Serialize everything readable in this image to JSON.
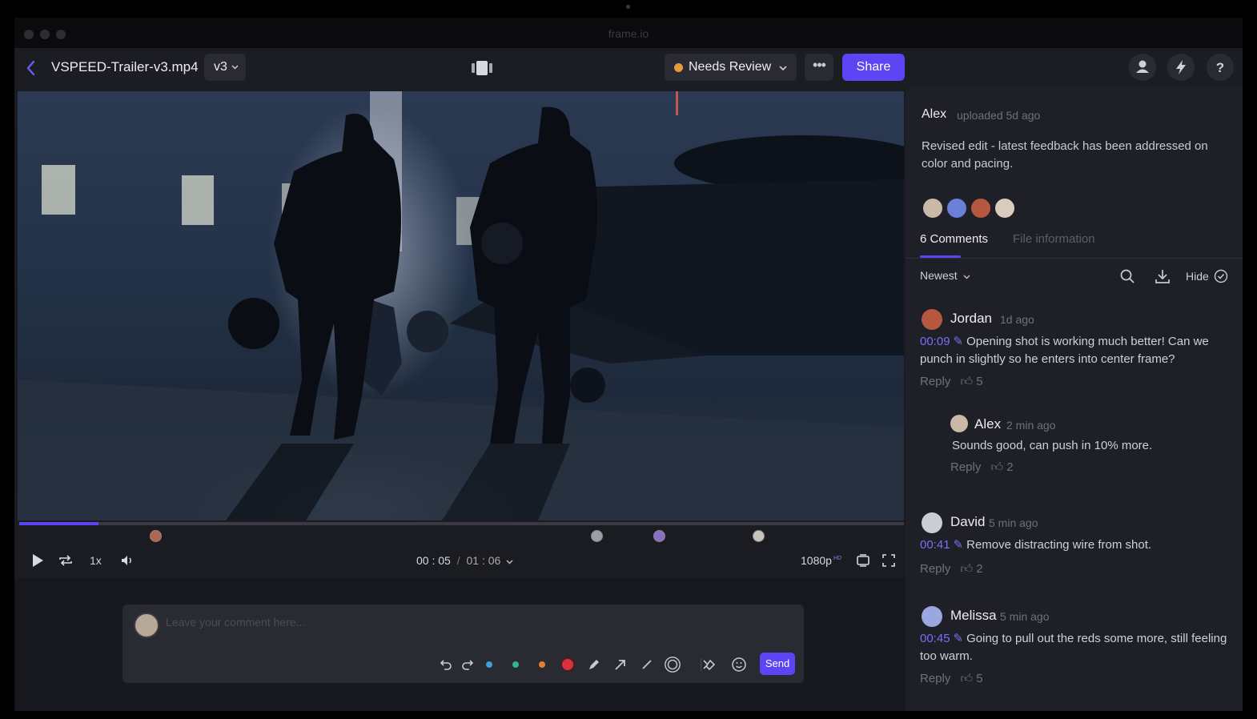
{
  "window": {
    "title": "frame.io"
  },
  "header": {
    "file_name": "VSPEED-Trailer-v3.mp4",
    "version": "v3",
    "status": "Needs Review",
    "status_color": "#e59a3e",
    "share_label": "Share",
    "more_label": "•••",
    "accent_color": "#5b45f5",
    "icons": [
      "back-chevron-icon",
      "multi-view-icon",
      "user-icon",
      "lightning-icon",
      "help-icon"
    ]
  },
  "player": {
    "progress": 0.09,
    "speed": "1x",
    "current_time": "00 : 05",
    "separator": "/",
    "duration": "01 : 06",
    "quality": "1080p",
    "quality_badge": "HD",
    "comment_markers_fraction": [
      0.155,
      0.65,
      0.72,
      0.83
    ]
  },
  "composer": {
    "placeholder": "Leave your comment here...",
    "send_label": "Send",
    "colors": [
      "#3aa1d9",
      "#2fb58f",
      "#e3812f",
      "#d9323a"
    ]
  },
  "panel": {
    "uploader": "Alex",
    "upload_meta": "uploaded 5d ago",
    "description": "Revised edit - latest feedback has been addressed on color and pacing.",
    "tabs": {
      "comments": "6 Comments",
      "file_info": "File information"
    },
    "sort_label": "Newest",
    "hide_label": "Hide"
  },
  "comments": [
    {
      "author": "Jordan",
      "time": "1d ago",
      "timecode": "00:09",
      "text": "Opening shot is working much better! Can we punch in slightly so he enters into center frame?",
      "reply_label": "Reply",
      "likes": "5"
    },
    {
      "author": "Alex",
      "time": "2 min ago",
      "text": "Sounds good, can push in 10% more.",
      "reply_label": "Reply",
      "likes": "2"
    },
    {
      "author": "David",
      "time": "5 min ago",
      "timecode": "00:41",
      "text": "Remove distracting wire from shot.",
      "reply_label": "Reply",
      "likes": "2"
    },
    {
      "author": "Melissa",
      "time": "5 min ago",
      "timecode": "00:45",
      "text": "Going to pull out the reds some more, still feeling too warm.",
      "reply_label": "Reply",
      "likes": "5"
    }
  ]
}
